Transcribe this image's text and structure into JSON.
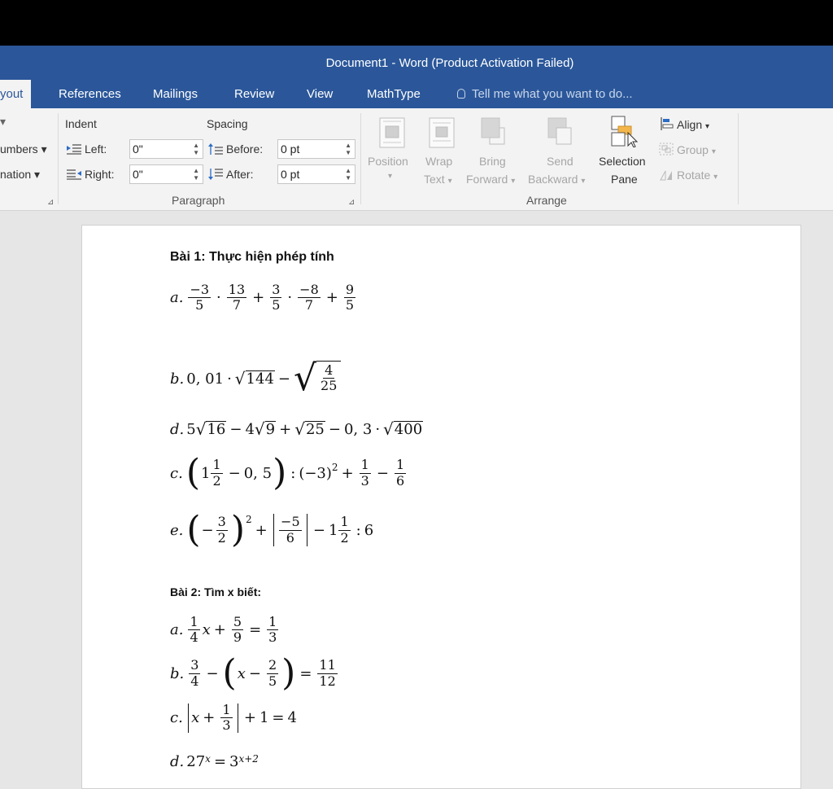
{
  "window": {
    "title": "Document1 - Word (Product Activation Failed)"
  },
  "tabs": {
    "layout_partial": "yout",
    "references": "References",
    "mailings": "Mailings",
    "review": "Review",
    "view": "View",
    "mathtype": "MathType",
    "tell_me": "Tell me what you want to do..."
  },
  "ribbon": {
    "left_clip": {
      "numbers": "umbers",
      "hyphenation": "nation"
    },
    "paragraph": {
      "indent_label": "Indent",
      "spacing_label": "Spacing",
      "left_label": "Left:",
      "right_label": "Right:",
      "before_label": "Before:",
      "after_label": "After:",
      "left_value": "0\"",
      "right_value": "0\"",
      "before_value": "0 pt",
      "after_value": "0 pt",
      "group_label": "Paragraph"
    },
    "arrange": {
      "position": "Position",
      "wrap_text_1": "Wrap",
      "wrap_text_2": "Text",
      "bring_forward_1": "Bring",
      "bring_forward_2": "Forward",
      "send_backward_1": "Send",
      "send_backward_2": "Backward",
      "selection_pane_1": "Selection",
      "selection_pane_2": "Pane",
      "align": "Align",
      "group": "Group",
      "rotate": "Rotate",
      "group_label": "Arrange"
    },
    "colors": {
      "brand": "#2b579a",
      "ribbon_bg": "#f3f3f3"
    }
  },
  "document": {
    "heading1": "Bài 1: Thực hiện phép tính",
    "heading2": "Bài 2: Tìm x biết:",
    "labels": {
      "a": "a.",
      "b": "b.",
      "c": "c.",
      "d": "d.",
      "e": "e."
    },
    "eq1a": {
      "n1": "−3",
      "d1": "5",
      "n2": "13",
      "d2": "7",
      "n3": "3",
      "d3": "5",
      "n4": "−8",
      "d4": "7",
      "n5": "9",
      "d5": "5"
    },
    "eq1b": {
      "coef": "0, 01",
      "root1": "144",
      "n": "4",
      "d": "25"
    },
    "eq1d": {
      "c1": "5",
      "r1": "16",
      "c2": "4",
      "r2": "9",
      "r3": "25",
      "c3": "0, 3",
      "r4": "400"
    },
    "eq1c": {
      "whole": "1",
      "n1": "1",
      "d1": "2",
      "dec": "0, 5",
      "base": "(−3)",
      "exp": "2",
      "n2": "1",
      "d2": "3",
      "n3": "1",
      "d3": "6"
    },
    "eq1e": {
      "n1": "3",
      "d1": "2",
      "exp": "2",
      "n2": "−5",
      "d2": "6",
      "whole": "1",
      "n3": "1",
      "d3": "2",
      "div": "6"
    },
    "eq2a": {
      "n1": "1",
      "d1": "4",
      "var": "x",
      "n2": "5",
      "d2": "9",
      "n3": "1",
      "d3": "3"
    },
    "eq2b": {
      "n1": "3",
      "d1": "4",
      "var": "x",
      "n2": "2",
      "d2": "5",
      "n3": "11",
      "d3": "12"
    },
    "eq2c": {
      "var": "x",
      "n1": "1",
      "d1": "3",
      "c1": "1",
      "rhs": "4"
    },
    "eq2d": {
      "base": "27",
      "exp": "x",
      "base2": "3",
      "exp2": "x+2"
    }
  }
}
